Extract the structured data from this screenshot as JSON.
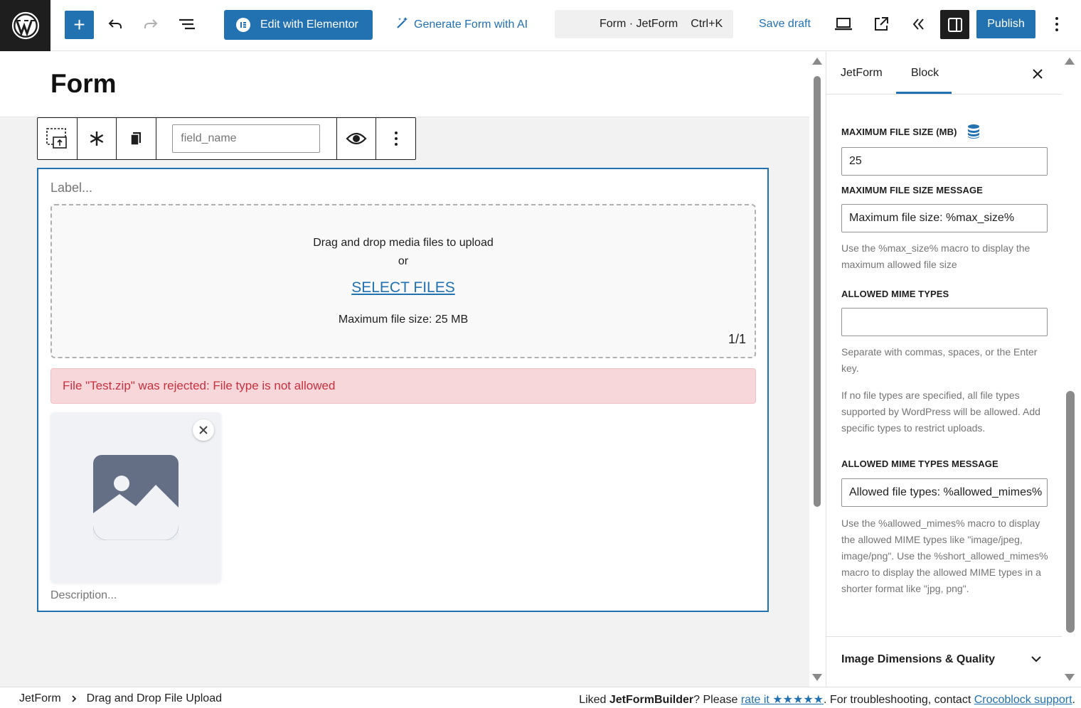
{
  "topbar": {
    "elementor_label": "Edit with Elementor",
    "ai_label": "Generate Form with AI",
    "command_title": "Form · JetForm",
    "command_shortcut": "Ctrl+K",
    "save_draft": "Save draft",
    "publish": "Publish"
  },
  "editor": {
    "title": "Form",
    "field_name_placeholder": "field_name",
    "label_placeholder": "Label...",
    "dropzone_line": "Drag and drop media files to upload",
    "dropzone_or": "or",
    "select_files": "SELECT FILES",
    "max_file_size": "Maximum file size: 25 MB",
    "file_count": "1/1",
    "error": "File \"Test.zip\" was rejected: File type is not allowed",
    "description_placeholder": "Description..."
  },
  "sidebar": {
    "tabs": [
      "JetForm",
      "Block"
    ],
    "active_tab": "Block",
    "max_size_label": "MAXIMUM FILE SIZE (MB)",
    "max_size_value": "25",
    "max_size_msg_label": "MAXIMUM FILE SIZE MESSAGE",
    "max_size_msg_value": "Maximum file size: %max_size%",
    "max_size_help": "Use the %max_size% macro to display the maximum allowed file size",
    "mime_label": "ALLOWED MIME TYPES",
    "mime_value": "",
    "mime_help1": "Separate with commas, spaces, or the Enter key.",
    "mime_help2": "If no file types are specified, all file types supported by WordPress will be allowed. Add specific types to restrict uploads.",
    "mime_msg_label": "ALLOWED MIME TYPES MESSAGE",
    "mime_msg_value": "Allowed file types: %allowed_mimes%",
    "mime_msg_help": "Use the %allowed_mimes% macro to display the allowed MIME types like \"image/jpeg, image/png\". Use the %short_allowed_mimes% macro to display the allowed MIME types in a shorter format like \"jpg, png\".",
    "image_dims": "Image Dimensions & Quality"
  },
  "footer": {
    "breadcrumb": [
      "JetForm",
      "Drag and Drop File Upload"
    ],
    "liked": "Liked ",
    "brand": "JetFormBuilder",
    "please": "? Please ",
    "rate": "rate it ★★★★★",
    "troubleshoot": ". For troubleshooting, contact ",
    "support": "Crocoblock support",
    "end": "."
  },
  "colors": {
    "accent": "#2271b1",
    "error_bg": "#f8d7da",
    "error_text": "#c9303f"
  }
}
